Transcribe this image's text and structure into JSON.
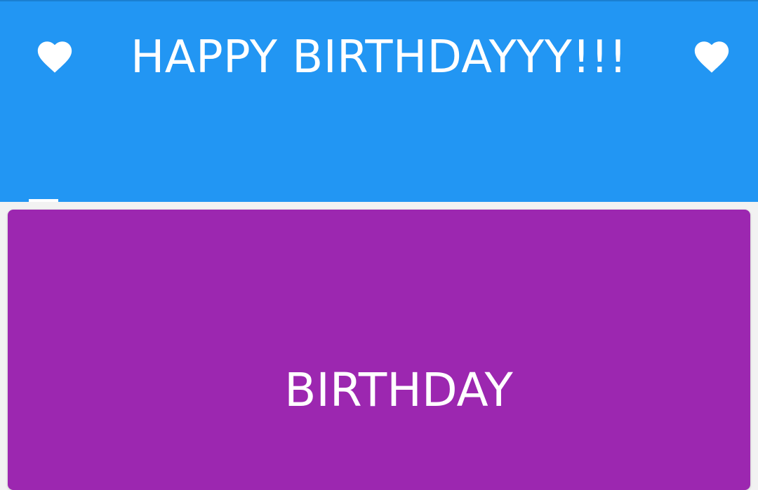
{
  "header": {
    "title": "HAPPY BIRTHDAYYY!!!",
    "left_icon": "heart-icon",
    "right_icon": "heart-icon",
    "background_color": "#2296f3",
    "text_color": "#ffffff"
  },
  "card": {
    "label": "BIRTHDAY",
    "background_color": "#9c27b0",
    "text_color": "#ffffff"
  },
  "theme": {
    "page_background": "#f2f2f2"
  }
}
